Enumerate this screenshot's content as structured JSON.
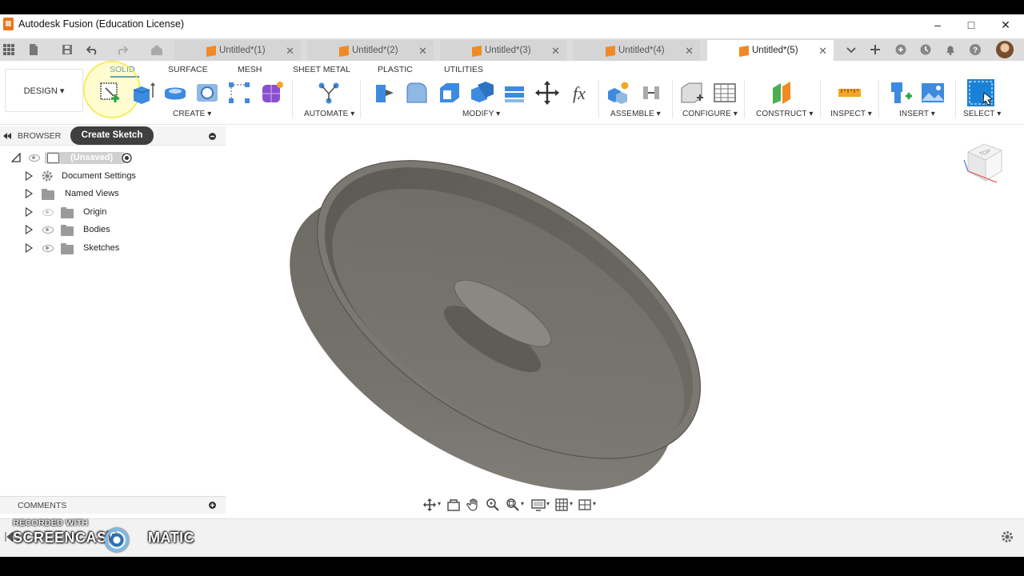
{
  "window": {
    "title": "Autodesk Fusion (Education License)",
    "minimize": "–",
    "maximize": "□",
    "close": "✕"
  },
  "tabs": [
    {
      "label": "Untitled*(1)",
      "active": false
    },
    {
      "label": "Untitled*(2)",
      "active": false
    },
    {
      "label": "Untitled*(3)",
      "active": false
    },
    {
      "label": "Untitled*(4)",
      "active": false
    },
    {
      "label": "Untitled*(5)",
      "active": true
    }
  ],
  "ribbon": {
    "workspace": "DESIGN ▾",
    "tabs": [
      "SOLID",
      "SURFACE",
      "MESH",
      "SHEET METAL",
      "PLASTIC",
      "UTILITIES"
    ],
    "active_tab": "SOLID",
    "groups": [
      "CREATE ▾",
      "AUTOMATE ▾",
      "MODIFY ▾",
      "ASSEMBLE ▾",
      "CONFIGURE ▾",
      "CONSTRUCT ▾",
      "INSPECT ▾",
      "INSERT ▾",
      "SELECT ▾"
    ]
  },
  "browser": {
    "title": "BROWSER",
    "tooltip": "Create Sketch",
    "root": "(Unsaved)",
    "items": [
      "Document Settings",
      "Named Views",
      "Origin",
      "Bodies",
      "Sketches"
    ]
  },
  "comments": {
    "title": "COMMENTS"
  },
  "viewcube": {
    "face": "TOP"
  },
  "watermark": {
    "line1": "RECORDED WITH",
    "line2a": "SCREENCAST",
    "line2b": "MATIC"
  },
  "colors": {
    "accent": "#1a73c7",
    "tab_icon": "#f08a24",
    "model": "#6f6d66"
  }
}
